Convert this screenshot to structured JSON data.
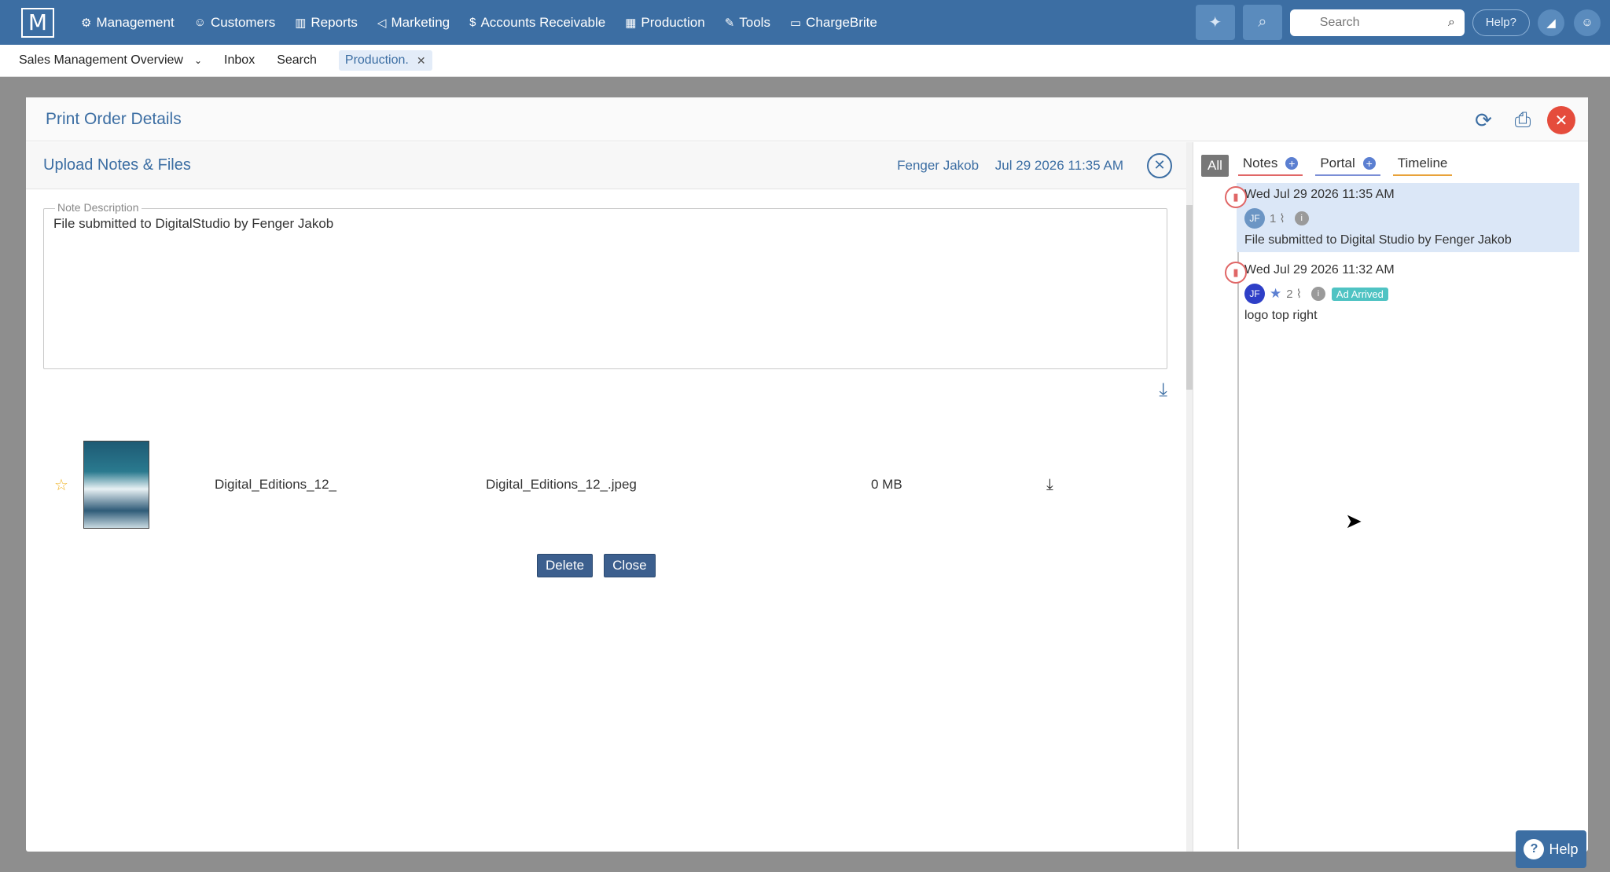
{
  "nav": {
    "logo": "M",
    "items": [
      {
        "icon": "⚙",
        "label": "Management",
        "name": "nav-management"
      },
      {
        "icon": "👥",
        "label": "Customers",
        "name": "nav-customers"
      },
      {
        "icon": "📊",
        "label": "Reports",
        "name": "nav-reports"
      },
      {
        "icon": "📣",
        "label": "Marketing",
        "name": "nav-marketing"
      },
      {
        "icon": "$",
        "label": "Accounts Receivable",
        "name": "nav-accounts-receivable"
      },
      {
        "icon": "▥",
        "label": "Production",
        "name": "nav-production"
      },
      {
        "icon": "🔧",
        "label": "Tools",
        "name": "nav-tools"
      },
      {
        "icon": "▭",
        "label": "ChargeBrite",
        "name": "nav-chargebrite"
      }
    ],
    "search_placeholder": "Search",
    "help_label": "Help?"
  },
  "subbar": {
    "items": [
      "Sales Management Overview",
      "Inbox",
      "Search"
    ],
    "active_tab": "Production."
  },
  "modal": {
    "title": "Print Order Details",
    "section_title": "Upload Notes & Files",
    "author": "Fenger Jakob",
    "datetime": "Jul 29 2026 11:35 AM",
    "note_legend": "Note Description",
    "note_text": "File submitted to DigitalStudio by Fenger Jakob",
    "file": {
      "name": "Digital_Editions_12_",
      "filename": "Digital_Editions_12_.jpeg",
      "size": "0 MB"
    },
    "buttons": {
      "delete": "Delete",
      "close": "Close"
    }
  },
  "panel": {
    "tabs": {
      "all": "All",
      "notes": "Notes",
      "portal": "Portal",
      "timeline": "Timeline"
    },
    "entries": [
      {
        "date": "Wed Jul 29 2026 11:35 AM",
        "avatar": "JF",
        "count": "1",
        "text": "File submitted to Digital Studio by Fenger Jakob",
        "badge": ""
      },
      {
        "date": "Wed Jul 29 2026 11:32 AM",
        "avatar": "JF",
        "count": "2",
        "text": "logo top right",
        "badge": "Ad Arrived"
      }
    ]
  },
  "help_button": "Help",
  "colors": {
    "brand": "#3c6ea3",
    "close_red": "#e54c3c",
    "badge": "#4fc3c3"
  }
}
